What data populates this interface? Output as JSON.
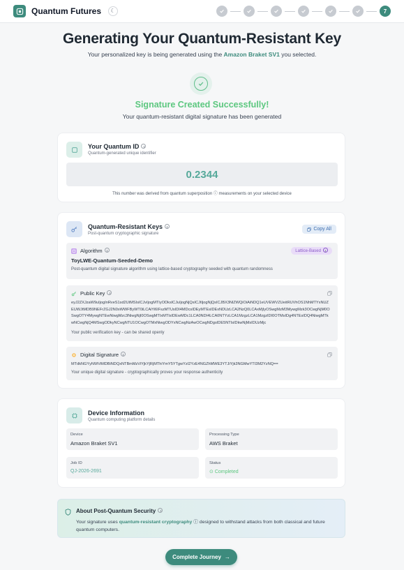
{
  "header": {
    "brand": "Quantum Futures",
    "steps": [
      "",
      "",
      "",
      "",
      "",
      "",
      "7"
    ],
    "current_step": 7
  },
  "hero": {
    "title": "Generating Your Quantum-Resistant Key",
    "subtitle_prefix": "Your personalized key is being generated using the ",
    "subtitle_device": "Amazon Braket SV1",
    "subtitle_suffix": " you selected.",
    "success_title": "Signature Created Successfully!",
    "success_sub": "Your quantum-resistant digital signature has been generated"
  },
  "quantum_id": {
    "title": "Your Quantum ID",
    "subtitle": "Quantum-generated unique identifier",
    "value": "0.2344",
    "note": "This number was derived from quantum superposition ⓘ measurements on your selected device"
  },
  "keys": {
    "title": "Quantum-Resistant Keys",
    "subtitle": "Post-quantum cryptographic signature",
    "copy_all": "Copy All",
    "algorithm": {
      "label": "Algorithm",
      "badge": "Lattice-Based",
      "name": "ToyLWE-Quantum-Seeded-Demo",
      "description": "Post-quantum digital signature algorithm using lattice-based cryptography seeded with quantum randomness"
    },
    "public_key": {
      "label": "Public Key",
      "value": "eyJ2ZXJzaW9uIjogInRveS1sd2UtMSIsICJvIjogMTIyODksICJuIjogNjQsICJtIjogNjQsICJBX3NlZWQiOiAiNDQ1eUVEWVZUeitRUVhOS1NhMTYxNUZEUWJtMDB9NEFrZGJ2N0xWWFByWT0iLCAiYi6IFszMTUsIDI4MDcsIDEyMTEsIDExNDUzLCA2NzQ0LCAxMjIyOSwgMzM3MywgMzk3OCwgNjM0OSwgOTY4MywgNTEwNiwgMzc3NiwgNjI0OSwgMTIxMTIsIDEwMDc1LCA0NDI4LCA0NTYzLCA1MzgzLCA1MzgzIDI0OTMsIDg4NTEsIDQ4NiwgMTkwNCwgNjQ4MSwgODkyNCwgNTU1OCwgOTMxNiwgODYxNCwgNzAwOCwgNDgsIDE5NTIsIDkwNjMsIDUzMjc",
      "note": "Your public verification key - can be shared openly"
    },
    "signature": {
      "label": "Digital Signature",
      "value": "MTdkNGYyNWViMDBiNDQxNTBmMzViYjkYjRjMThiYmY5YTgwYzI2YzE4NGZhMWE3YTJiYjk3NGMwYTI3M2YzNQ==",
      "note": "Your unique digital signature - cryptographically proves your response authenticity"
    }
  },
  "device": {
    "title": "Device Information",
    "subtitle": "Quantum computing platform details",
    "fields": [
      {
        "label": "Device",
        "value": "Amazon Braket SV1"
      },
      {
        "label": "Processing Type",
        "value": "AWS Braket"
      },
      {
        "label": "Job ID",
        "value": "QJ-2026-2691"
      },
      {
        "label": "Status",
        "value": "Completed"
      }
    ]
  },
  "about": {
    "title": "About Post-Quantum Security",
    "text_prefix": "Your signature uses ",
    "text_accent": "quantum-resistant cryptography",
    "text_suffix": " ⓘ designed to withstand attacks from both classical and future quantum computers."
  },
  "cta": {
    "label": "Complete Journey"
  },
  "colors": {
    "accent": "#3d8b7d",
    "success": "#5cc77f",
    "lattice": "#8b5cc8"
  }
}
